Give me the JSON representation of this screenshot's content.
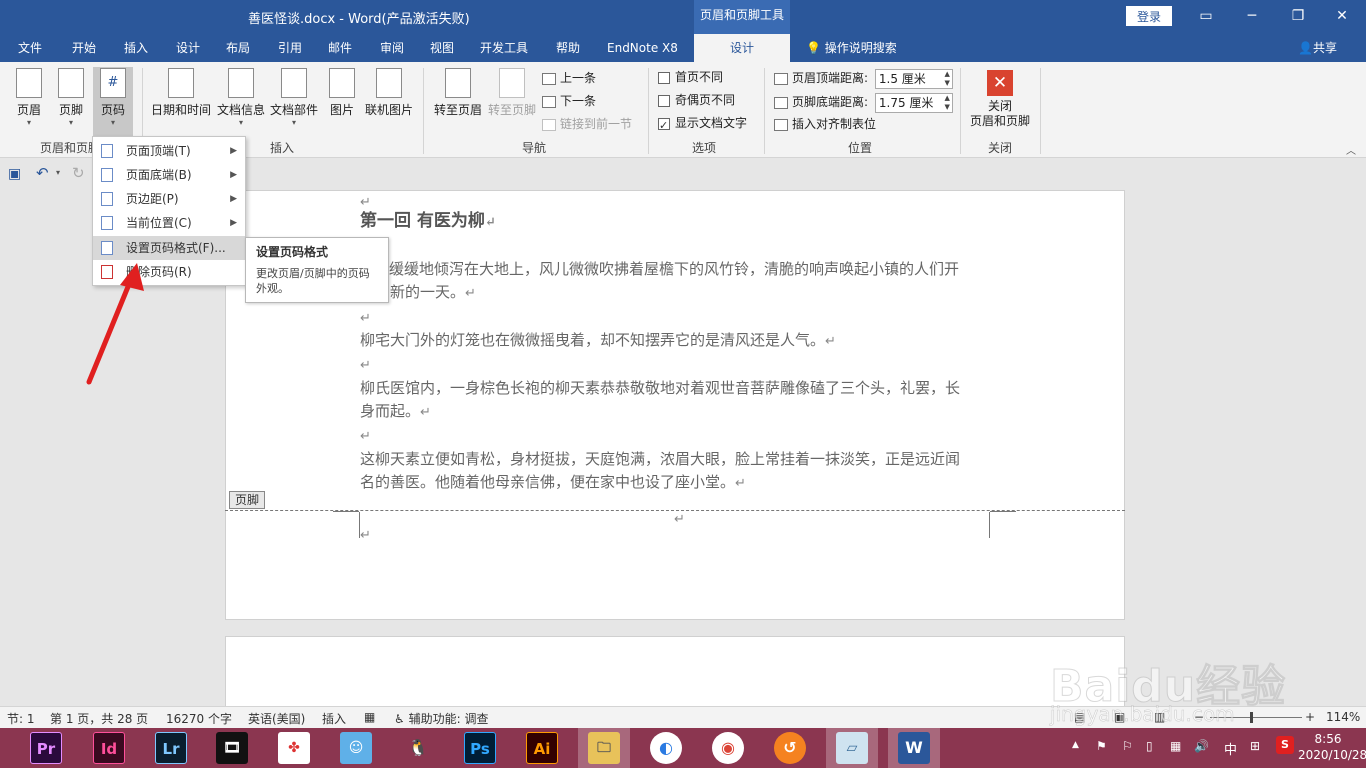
{
  "titlebar": {
    "title": "善医怪谈.docx  -  Word(产品激活失败)",
    "context_tool": "页眉和页脚工具",
    "login": "登录"
  },
  "tabs": [
    "文件",
    "开始",
    "插入",
    "设计",
    "布局",
    "引用",
    "邮件",
    "审阅",
    "视图",
    "开发工具",
    "帮助",
    "EndNote X8",
    "设计"
  ],
  "tell_me": "操作说明搜索",
  "share": "共享",
  "ribbon": {
    "header": "页眉",
    "footer": "页脚",
    "page_number": "页码",
    "group_header_footer": "页眉和页脚",
    "datetime": "日期和时间",
    "docinfo": "文档信息",
    "quickparts": "文档部件",
    "picture": "图片",
    "online_picture": "联机图片",
    "group_insert": "插入",
    "goto_header": "转至页眉",
    "goto_footer": "转至页脚",
    "prev": "上一条",
    "next": "下一条",
    "link_prev": "链接到前一节",
    "group_nav": "导航",
    "diff_first": "首页不同",
    "diff_odd_even": "奇偶页不同",
    "show_text": "显示文档文字",
    "group_options": "选项",
    "header_top": "页眉顶端距离:",
    "header_top_val": "1.5 厘米",
    "footer_bottom": "页脚底端距离:",
    "footer_bottom_val": "1.75 厘米",
    "insert_align_tab": "插入对齐制表位",
    "group_position": "位置",
    "close_line1": "关闭",
    "close_line2": "页眉和页脚",
    "group_close": "关闭"
  },
  "menu": {
    "items": [
      "页面顶端(T)",
      "页面底端(B)",
      "页边距(P)",
      "当前位置(C)",
      "设置页码格式(F)...",
      "删除页码(R)"
    ]
  },
  "tooltip": {
    "title": "设置页码格式",
    "body": "更改页眉/页脚中的页码外观。"
  },
  "document": {
    "heading": "第一回  有医为柳",
    "p1a": "光缓缓地倾泻在大地上，风儿微微吹拂着屋檐下的风竹铃，清脆的响声唤起小镇的人们开",
    "p1b": "新的一天。",
    "p2": "柳宅大门外的灯笼也在微微摇曳着，却不知摆弄它的是清风还是人气。",
    "p3a": "柳氏医馆内，一身棕色长袍的柳天素恭恭敬敬地对着观世音菩萨雕像磕了三个头，礼罢，长",
    "p3b": "身而起。",
    "p4a": "这柳天素立便如青松，身材挺拔，天庭饱满，浓眉大眼，脸上常挂着一抹淡笑，正是远近闻",
    "p4b": "名的善医。他随着他母亲信佛，便在家中也设了座小堂。",
    "pilcrow": "↵",
    "footer_tag": "页脚"
  },
  "statusbar": {
    "section": "节: 1",
    "page": "第 1 页，共 28 页",
    "words": "16270 个字",
    "lang": "英语(美国)",
    "insert": "插入",
    "accessibility": "辅助功能: 调查",
    "zoom": "114%"
  },
  "taskbar": {
    "apps": [
      "Pr",
      "Id",
      "Lr",
      "Ai",
      "Ps"
    ],
    "ime": "中",
    "time": "8:56",
    "date": "2020/10/28"
  },
  "watermark": {
    "logo": "Baidu经验",
    "url": "jingyan.baidu.com"
  },
  "colors": {
    "word_blue": "#2b579a",
    "taskbar": "#8b3650",
    "close_red": "#d9432f"
  }
}
